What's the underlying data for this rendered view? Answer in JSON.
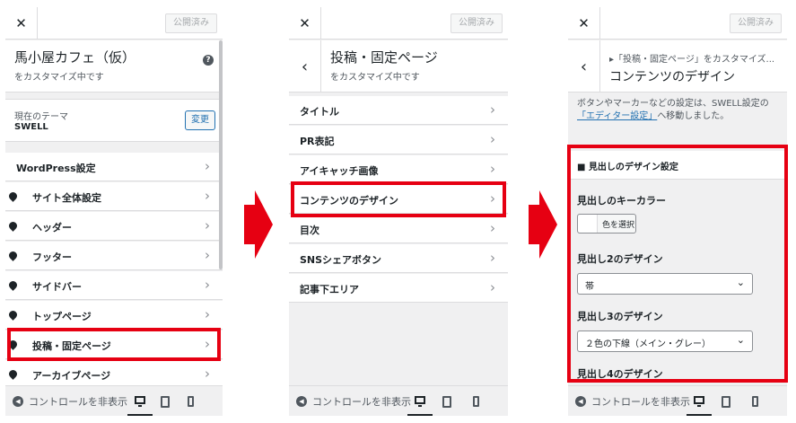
{
  "common": {
    "close": "✕",
    "publish": "公開済み",
    "hide_controls": "コントロールを非表示",
    "back": "‹",
    "chevron": "›"
  },
  "panel1": {
    "title": "馬小屋カフェ（仮）",
    "subtitle": "をカスタマイズ中です",
    "help": "?",
    "theme_current": "現在のテーマ",
    "theme_name": "SWELL",
    "theme_change": "変更",
    "items": [
      {
        "label": "WordPress設定",
        "icon": false
      },
      {
        "label": "サイト全体設定",
        "icon": true
      },
      {
        "label": "ヘッダー",
        "icon": true
      },
      {
        "label": "フッター",
        "icon": true
      },
      {
        "label": "サイドバー",
        "icon": true
      },
      {
        "label": "トップページ",
        "icon": true
      },
      {
        "label": "投稿・固定ページ",
        "icon": true
      },
      {
        "label": "アーカイブページ",
        "icon": true
      }
    ]
  },
  "panel2": {
    "title": "投稿・固定ページ",
    "subtitle": "をカスタマイズ中です",
    "items": [
      {
        "label": "タイトル"
      },
      {
        "label": "PR表記"
      },
      {
        "label": "アイキャッチ画像"
      },
      {
        "label": "コンテンツのデザイン"
      },
      {
        "label": "目次"
      },
      {
        "label": "SNSシェアボタン"
      },
      {
        "label": "記事下エリア"
      }
    ]
  },
  "panel3": {
    "breadcrumb": "▸「投稿・固定ページ」をカスタマイズ...",
    "title": "コンテンツのデザイン",
    "notice_pre": "ボタンやマーカーなどの設定は、SWELL設定の",
    "notice_link": "「エディター設定」",
    "notice_post": "へ移動しました。",
    "section": "■ 見出しのデザイン設定",
    "key_color_label": "見出しのキーカラー",
    "color_select": "色を選択",
    "h2_label": "見出し2のデザイン",
    "h2_value": "帯",
    "h3_label": "見出し3のデザイン",
    "h3_value": "２色の下線（メイン・グレー）",
    "h4_label": "見出し4のデザイン",
    "dropdown_icon": "⌄"
  },
  "colors": {
    "highlight": "#e60012",
    "link": "#2271b1"
  }
}
